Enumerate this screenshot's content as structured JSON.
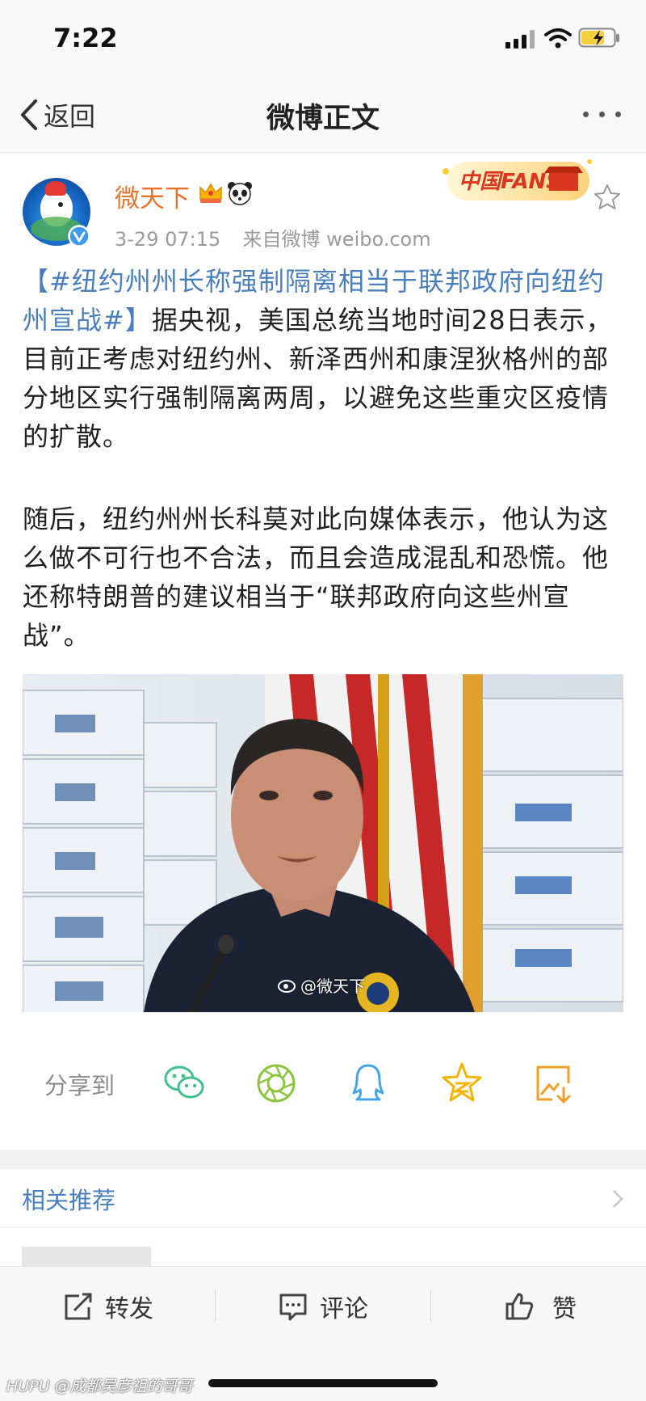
{
  "status_bar": {
    "time": "7:22"
  },
  "nav": {
    "back_label": "返回",
    "title": "微博正文"
  },
  "post": {
    "username": "微天下",
    "timestamp": "3-29 07:15",
    "source": "来自微博 weibo.com",
    "badge_text": "中国FANS",
    "topic": "【#纽约州州长称强制隔离相当于联邦政府向纽约州宣战#】",
    "para1_rest": "据央视，美国总统当地时间28日表示，目前正考虑对纽约州、新泽西州和康涅狄格州的部分地区实行强制隔离两周，以避免这些重灾区疫情的扩散。",
    "para2": "随后，纽约州州长科莫对此向媒体表示，他认为这么做不可行也不合法，而且会造成混乱和恐慌。他还称特朗普的建议相当于“联邦政府向这些州宣战”。",
    "image_watermark": "@微天下"
  },
  "share": {
    "label": "分享到",
    "targets": [
      "wechat-icon",
      "moments-icon",
      "qq-icon",
      "qzone-icon",
      "save-image-icon"
    ]
  },
  "related": {
    "label": "相关推荐"
  },
  "toolbar": {
    "repost_label": "转发",
    "comment_label": "评论",
    "like_label": "赞"
  },
  "watermark": "HUPU @成都吴彦祖的哥哥",
  "colors": {
    "accent_link": "#4a7fbe",
    "username": "#e8742b",
    "wechat": "#3fc08c",
    "qq": "#45a4e6",
    "star": "#f4b400"
  }
}
